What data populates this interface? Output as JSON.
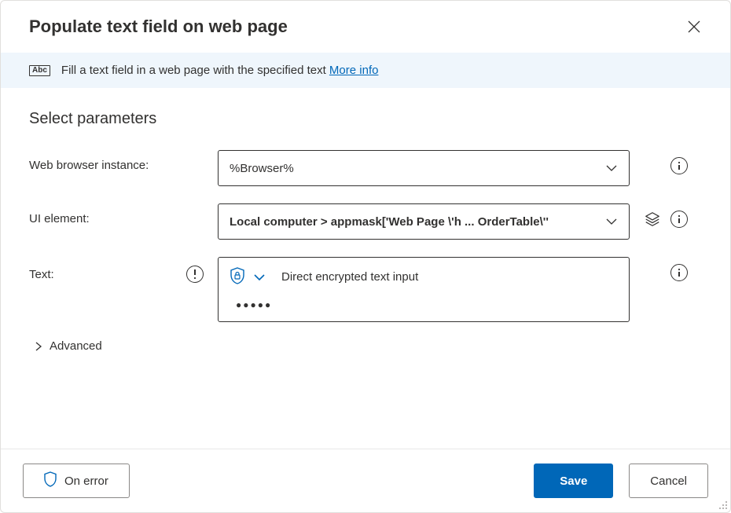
{
  "header": {
    "title": "Populate text field on web page"
  },
  "info_bar": {
    "icon_text": "Abc",
    "text": "Fill a text field in a web page with the specified text ",
    "link_text": "More info"
  },
  "section_title": "Select parameters",
  "params": {
    "browser": {
      "label": "Web browser instance:",
      "value": "%Browser%"
    },
    "ui_element": {
      "label": "UI element:",
      "value": "Local computer > appmask['Web Page \\'h ... OrderTable\\''"
    },
    "text": {
      "label": "Text:",
      "mode": "Direct encrypted text input",
      "value": "●●●●●"
    }
  },
  "advanced_label": "Advanced",
  "footer": {
    "on_error": "On error",
    "save": "Save",
    "cancel": "Cancel"
  }
}
